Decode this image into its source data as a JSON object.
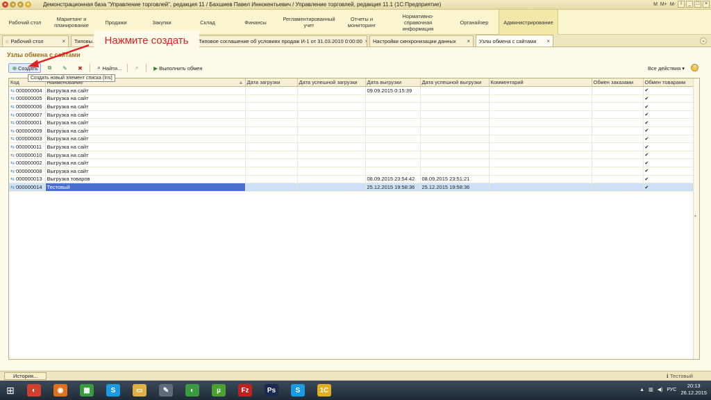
{
  "window": {
    "title": "Демонстрационная база \"Управление торговлей\", редакция 11 / Бахшиев Павел Иннокентьевич / Управление торговлей, редакция 11.1  (1С:Предприятие)",
    "controls": [
      "M",
      "M+",
      "M-",
      "i",
      "_",
      "□",
      "×"
    ]
  },
  "sections": [
    {
      "label": "Рабочий стол"
    },
    {
      "label": "Маркетинг и планирование"
    },
    {
      "label": "Продажи"
    },
    {
      "label": "Закупки"
    },
    {
      "label": "Склад"
    },
    {
      "label": "Финансы"
    },
    {
      "label": "Регламентированный учет"
    },
    {
      "label": "Отчеты и мониторинг"
    },
    {
      "label": "Нормативно-справочная информация"
    },
    {
      "label": "Органайзер"
    },
    {
      "label": "Администрирование"
    }
  ],
  "tabs": [
    {
      "label": "Рабочий стол"
    },
    {
      "label": "Типовы..."
    },
    {
      "label": "Типовое соглашение об условиях продаж И-1 от 31.03.2010 0:00:00"
    },
    {
      "label": "Настройки синхронизации данных"
    },
    {
      "label": "Узлы обмена с сайтами"
    }
  ],
  "form": {
    "title": "Узлы обмена с сайтами",
    "toolbar": {
      "create": "Создать",
      "find": "Найти...",
      "run_exchange": "Выполнить обмен",
      "all_actions": "Все действия ▾",
      "help": "?"
    },
    "tooltip": "Создать новый элемент списка (Ins)"
  },
  "annotation": {
    "text": "Нажмите создать",
    "color": "#e02020"
  },
  "table": {
    "columns": [
      "Код",
      "Наименование",
      "Дата загрузки",
      "Дата успешной загрузки",
      "Дата выгрузки",
      "Дата успешной выгрузки",
      "Комментарий",
      "Обмен заказами",
      "Обмен товарами"
    ],
    "rows": [
      {
        "code": "000000004",
        "name": "Выгрузка на сайт",
        "load": "",
        "load_ok": "",
        "unload": "09.09.2015 0:15:39",
        "unload_ok": "",
        "comment": "",
        "orders": "",
        "goods": "✔"
      },
      {
        "code": "000000005",
        "name": "Выгрузка на сайт",
        "load": "",
        "load_ok": "",
        "unload": "",
        "unload_ok": "",
        "comment": "",
        "orders": "",
        "goods": "✔"
      },
      {
        "code": "000000006",
        "name": "Выгрузка на сайт",
        "load": "",
        "load_ok": "",
        "unload": "",
        "unload_ok": "",
        "comment": "",
        "orders": "",
        "goods": "✔"
      },
      {
        "code": "000000007",
        "name": "Выгрузка на сайт",
        "load": "",
        "load_ok": "",
        "unload": "",
        "unload_ok": "",
        "comment": "",
        "orders": "",
        "goods": "✔"
      },
      {
        "code": "000000001",
        "name": "Выгрузка на сайт",
        "load": "",
        "load_ok": "",
        "unload": "",
        "unload_ok": "",
        "comment": "",
        "orders": "",
        "goods": "✔"
      },
      {
        "code": "000000009",
        "name": "Выгрузка на сайт",
        "load": "",
        "load_ok": "",
        "unload": "",
        "unload_ok": "",
        "comment": "",
        "orders": "",
        "goods": "✔"
      },
      {
        "code": "000000003",
        "name": "Выгрузка на сайт",
        "load": "",
        "load_ok": "",
        "unload": "",
        "unload_ok": "",
        "comment": "",
        "orders": "",
        "goods": "✔"
      },
      {
        "code": "000000011",
        "name": "Выгрузка на сайт",
        "load": "",
        "load_ok": "",
        "unload": "",
        "unload_ok": "",
        "comment": "",
        "orders": "",
        "goods": "✔"
      },
      {
        "code": "000000010",
        "name": "Выгрузка на сайт",
        "load": "",
        "load_ok": "",
        "unload": "",
        "unload_ok": "",
        "comment": "",
        "orders": "",
        "goods": "✔"
      },
      {
        "code": "000000002",
        "name": "Выгрузка на сайт",
        "load": "",
        "load_ok": "",
        "unload": "",
        "unload_ok": "",
        "comment": "",
        "orders": "",
        "goods": "✔"
      },
      {
        "code": "000000008",
        "name": "Выгрузка на сайт",
        "load": "",
        "load_ok": "",
        "unload": "",
        "unload_ok": "",
        "comment": "",
        "orders": "",
        "goods": "✔"
      },
      {
        "code": "000000013",
        "name": "Выгрузка товаров",
        "load": "",
        "load_ok": "",
        "unload": "08.09.2015 23:54:42",
        "unload_ok": "08.09.2015 23:51:21",
        "comment": "",
        "orders": "",
        "goods": "✔"
      },
      {
        "code": "000000014",
        "name": "Тестовый",
        "load": "",
        "load_ok": "",
        "unload": "25.12.2015 19:58:36",
        "unload_ok": "25.12.2015 19:58:36",
        "comment": "",
        "orders": "",
        "goods": "✔",
        "selected": true
      }
    ]
  },
  "history": {
    "button": "История...",
    "status": "Тестовый"
  },
  "taskbar": {
    "items": [
      {
        "icon": "chrome-icon",
        "color": "#d04030",
        "glyph": "◐"
      },
      {
        "icon": "firefox-icon",
        "color": "#e07020",
        "glyph": "◉"
      },
      {
        "icon": "calculator-icon",
        "color": "#3a9a40",
        "glyph": "▦"
      },
      {
        "icon": "skype-icon",
        "color": "#1a9ae0",
        "glyph": "S"
      },
      {
        "icon": "folder-icon",
        "color": "#e0b040",
        "glyph": "▭"
      },
      {
        "icon": "tool-icon",
        "color": "#606a78",
        "glyph": "✎"
      },
      {
        "icon": "chrome-icon",
        "color": "#3a9a40",
        "glyph": "◐"
      },
      {
        "icon": "utorrent-icon",
        "color": "#4aa030",
        "glyph": "µ"
      },
      {
        "icon": "filezilla-icon",
        "color": "#c02020",
        "glyph": "Fz"
      },
      {
        "icon": "photoshop-icon",
        "color": "#1a2a50",
        "glyph": "Ps"
      },
      {
        "icon": "skype-icon",
        "color": "#1a9ae0",
        "glyph": "S"
      },
      {
        "icon": "1c-icon",
        "color": "#e0b020",
        "glyph": "1С"
      }
    ],
    "language": "РУС",
    "time": "20:13",
    "date": "26.12.2015"
  }
}
